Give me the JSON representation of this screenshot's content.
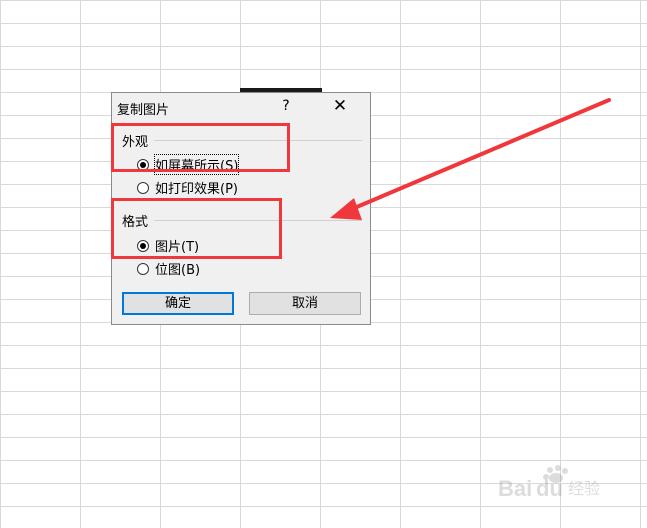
{
  "dialog": {
    "title": "复制图片",
    "help_label": "?",
    "close_label": "✕",
    "appearance": {
      "label": "外观",
      "options": [
        {
          "label": "如屏幕所示(S)",
          "checked": true
        },
        {
          "label": "如打印效果(P)",
          "checked": false
        }
      ]
    },
    "format": {
      "label": "格式",
      "options": [
        {
          "label": "图片(T)",
          "checked": true
        },
        {
          "label": "位图(B)",
          "checked": false
        }
      ]
    },
    "ok_label": "确定",
    "cancel_label": "取消"
  },
  "colors": {
    "highlight": "#f0373c",
    "dialog_bg": "#f0f0f0",
    "default_button_border": "#0078d7",
    "grid_line": "#d9d9d9"
  },
  "watermark": "Baidu经验"
}
